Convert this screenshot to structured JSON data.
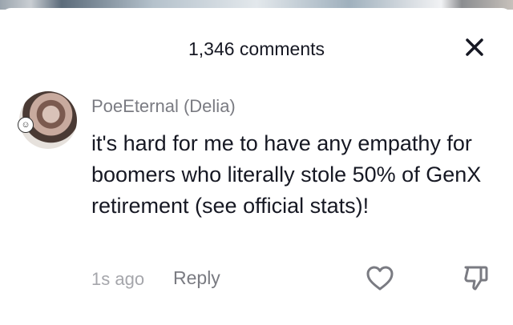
{
  "header": {
    "title": "1,346 comments",
    "close_icon": "close-icon"
  },
  "comment": {
    "avatar_icon": "avatar",
    "username": "PoeEternal (Delia)",
    "text": "it's hard for me to have any empathy for boomers who literally stole 50% of GenX retirement (see official stats)!",
    "timestamp": "1s ago",
    "reply_label": "Reply",
    "like_icon": "heart-icon",
    "dislike_icon": "thumbs-down-icon"
  },
  "colors": {
    "primary_text": "#161823",
    "secondary_text": "#7a7b82",
    "muted_text": "#a5a6ab"
  }
}
